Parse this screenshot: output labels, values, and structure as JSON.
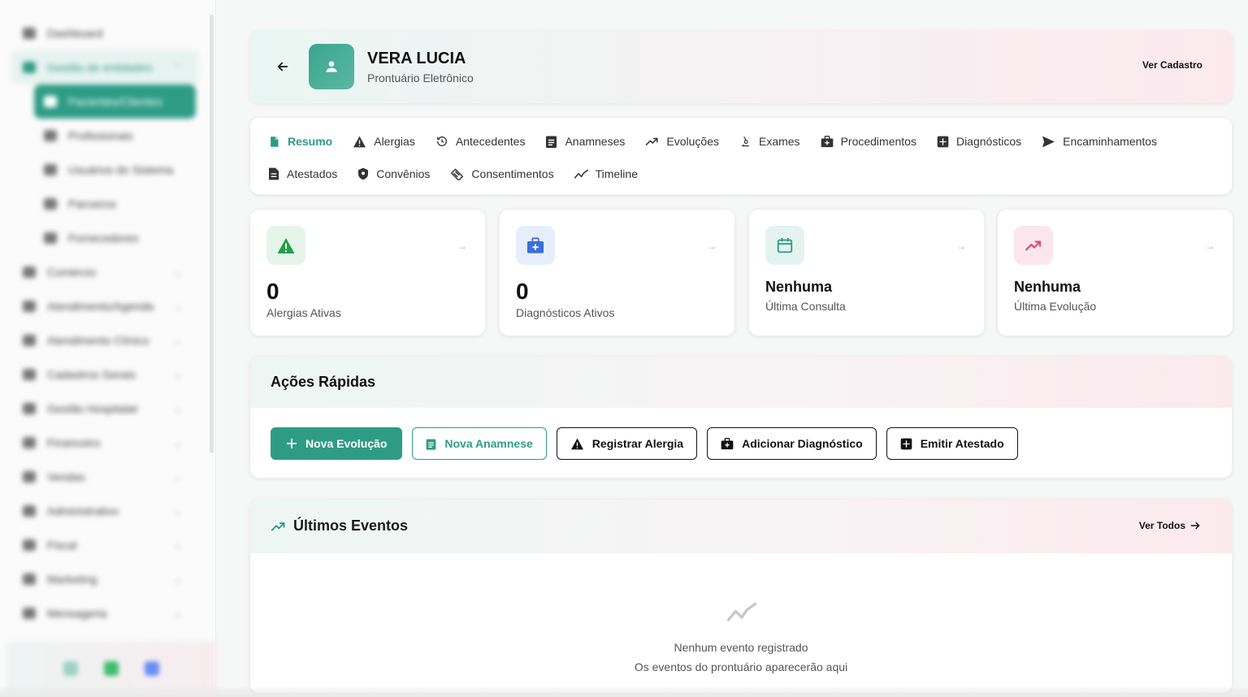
{
  "sidebar": {
    "items": [
      {
        "label": "Dashboard"
      },
      {
        "label": "Gestão de entidades"
      },
      {
        "label": "Pacientes/Clientes"
      },
      {
        "label": "Profissionais"
      },
      {
        "label": "Usuários do Sistema"
      },
      {
        "label": "Parceiros"
      },
      {
        "label": "Fornecedores"
      },
      {
        "label": "Comércio"
      },
      {
        "label": "Atendimento/Agenda"
      },
      {
        "label": "Atendimento Clínico"
      },
      {
        "label": "Cadastros Gerais"
      },
      {
        "label": "Gestão Hospitalar"
      },
      {
        "label": "Financeiro"
      },
      {
        "label": "Vendas"
      },
      {
        "label": "Administrativo"
      },
      {
        "label": "Fiscal"
      },
      {
        "label": "Marketing"
      },
      {
        "label": "Mensageria"
      }
    ]
  },
  "header": {
    "patient_name": "VERA LUCIA",
    "subtitle": "Prontuário Eletrônico",
    "ver_cadastro": "Ver Cadastro"
  },
  "tabs": {
    "row1": [
      "Resumo",
      "Alergias",
      "Antecedentes",
      "Anamneses",
      "Evoluções",
      "Exames",
      "Procedimentos",
      "Diagnósticos",
      "Encaminhamentos"
    ],
    "row2": [
      "Atestados",
      "Convênios",
      "Consentimentos",
      "Timeline"
    ],
    "active": "Resumo"
  },
  "stats": [
    {
      "value": "0",
      "label": "Alergias Ativas",
      "color": "#22a04b",
      "bg": "#e6f5ea",
      "icon": "warning-icon"
    },
    {
      "value": "0",
      "label": "Diagnósticos Ativos",
      "color": "#3b6fd9",
      "bg": "#e7eefb",
      "icon": "medical-kit-icon"
    },
    {
      "value": "Nenhuma",
      "label": "Última Consulta",
      "color": "#2e9c85",
      "bg": "#e4f3ef",
      "icon": "calendar-icon"
    },
    {
      "value": "Nenhuma",
      "label": "Última Evolução",
      "color": "#e2447a",
      "bg": "#fbe6ee",
      "icon": "trend-up-icon"
    }
  ],
  "acoes": {
    "title": "Ações Rápidas",
    "buttons": [
      "Nova Evolução",
      "Nova Anamnese",
      "Registrar Alergia",
      "Adicionar Diagnóstico",
      "Emitir Atestado"
    ]
  },
  "eventos": {
    "title": "Últimos Eventos",
    "ver_todos": "Ver Todos",
    "empty_title": "Nenhum evento registrado",
    "empty_sub": "Os eventos do prontuário aparecerão aqui"
  },
  "colors": {
    "accent": "#2e9c85",
    "pink": "#e2447a",
    "blue": "#3b6fd9",
    "green": "#22a04b"
  }
}
